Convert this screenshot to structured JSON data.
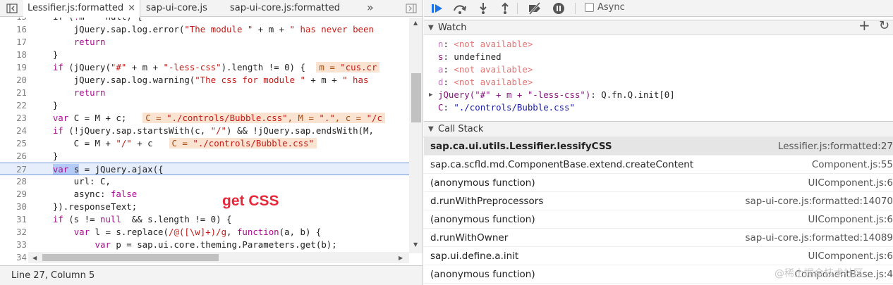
{
  "source_panel": {
    "tabs": [
      {
        "label": "Lessifier.js:formatted",
        "close": "×",
        "active": true
      },
      {
        "label": "sap-ui-core.js",
        "active": false
      },
      {
        "label": "sap-ui-core.js:formatted",
        "active": false
      }
    ],
    "overflow": "»",
    "code_lines": [
      {
        "n": "15",
        "html": "    if (<span class=\"kw\">!</span>m    null) {"
      },
      {
        "n": "16",
        "html": "        jQuery.sap.log.error(<span class=\"str\">\"The module \"</span> + m + <span class=\"str\">\" has never been</span>"
      },
      {
        "n": "17",
        "html": "        <span class=\"kw\">return</span>"
      },
      {
        "n": "18",
        "html": "    }"
      },
      {
        "n": "19",
        "html": "    <span class=\"kw\">if</span> (jQuery(<span class=\"str\">\"#\"</span> + m + <span class=\"str\">\"-less-css\"</span>).length != 0) { <span class=\"dv\">m = <span class=\"s2\">\"cus.cr</span></span>"
      },
      {
        "n": "20",
        "html": "        jQuery.sap.log.warning(<span class=\"str\">\"The css for module \"</span> + m + <span class=\"str\">\" has</span>"
      },
      {
        "n": "21",
        "html": "        <span class=\"kw\">return</span>"
      },
      {
        "n": "22",
        "html": "    }"
      },
      {
        "n": "23",
        "html": "    <span class=\"kw\">var</span> C = M + c;  <span class=\"dv\">C = <span class=\"s2\">\"./controls/Bubble.css\"</span>, M = <span class=\"s2\">\".\"</span>, c = <span class=\"s2\">\"/c</span></span>"
      },
      {
        "n": "24",
        "html": "    <span class=\"kw\">if</span> (!jQuery.sap.startsWith(c, <span class=\"str\">\"/\"</span>) &amp;&amp; !jQuery.sap.endsWith(M,"
      },
      {
        "n": "25",
        "html": "        C = M + <span class=\"str\">\"/\"</span> + c  <span class=\"dv\">C = <span class=\"s2\">\"./controls/Bubble.css\"</span></span>"
      },
      {
        "n": "26",
        "html": "    }"
      },
      {
        "n": "27",
        "html": "    <span class=\"sel\"><span class=\"kw\">var</span> s</span> = jQuery.ajax({",
        "current": true
      },
      {
        "n": "28",
        "html": "        url: C,"
      },
      {
        "n": "29",
        "html": "        async: <span class=\"kw\">false</span>"
      },
      {
        "n": "30",
        "html": "    }).responseText;"
      },
      {
        "n": "31",
        "html": "    <span class=\"kw\">if</span> (s != <span class=\"kw\">null</span>  &amp;&amp; s.length != 0) {"
      },
      {
        "n": "32",
        "html": "        <span class=\"kw\">var</span> l = s.replace(<span class=\"str\">/@([\\w]+)/g</span>, <span class=\"kw\">function</span>(a, b) {"
      },
      {
        "n": "33",
        "html": "            <span class=\"kw\">var</span> p = sap.ui.core.theming.Parameters.get(b);"
      },
      {
        "n": "34",
        "html": ""
      }
    ],
    "status": "Line 27, Column 5",
    "annotation": "get CSS"
  },
  "debugger": {
    "async_label": "Async",
    "async_checked": false,
    "watch": {
      "title": "Watch",
      "add": "+",
      "refresh": "↻",
      "items": [
        {
          "name": "n",
          "value": "<not available>",
          "na": true
        },
        {
          "name": "s",
          "value": "undefined",
          "na": false
        },
        {
          "name": "a",
          "value": "<not available>",
          "na": true
        },
        {
          "name": "d",
          "value": "<not available>",
          "na": true
        },
        {
          "name": "jQuery(\"#\" + m + \"-less-css\")",
          "value": "Q.fn.Q.init[0]",
          "na": false,
          "expandable": true
        },
        {
          "name": "C",
          "value": "\"./controls/Bubble.css\"",
          "na": false,
          "string": true
        }
      ]
    },
    "call_stack": {
      "title": "Call Stack",
      "frames": [
        {
          "fn": "sap.ca.ui.utils.Lessifier.lessifyCSS",
          "loc": "Lessifier.js:formatted:27",
          "selected": true
        },
        {
          "fn": "sap.ca.scfld.md.ComponentBase.extend.createContent",
          "loc": "Component.js:55"
        },
        {
          "fn": "(anonymous function)",
          "loc": "UIComponent.js:6"
        },
        {
          "fn": "d.runWithPreprocessors",
          "loc": "sap-ui-core.js:formatted:14070"
        },
        {
          "fn": "(anonymous function)",
          "loc": "UIComponent.js:6"
        },
        {
          "fn": "d.runWithOwner",
          "loc": "sap-ui-core.js:formatted:14089"
        },
        {
          "fn": "sap.ui.define.a.init",
          "loc": "UIComponent.js:6"
        },
        {
          "fn": "(anonymous function)",
          "loc": "ComponentBase.js:4"
        }
      ]
    }
  },
  "watermark": "@稀土掘金技术社区",
  "colors": {
    "accent": "#1a73e8",
    "annotation": "#e8283a",
    "current_line": "#e6edfb"
  }
}
